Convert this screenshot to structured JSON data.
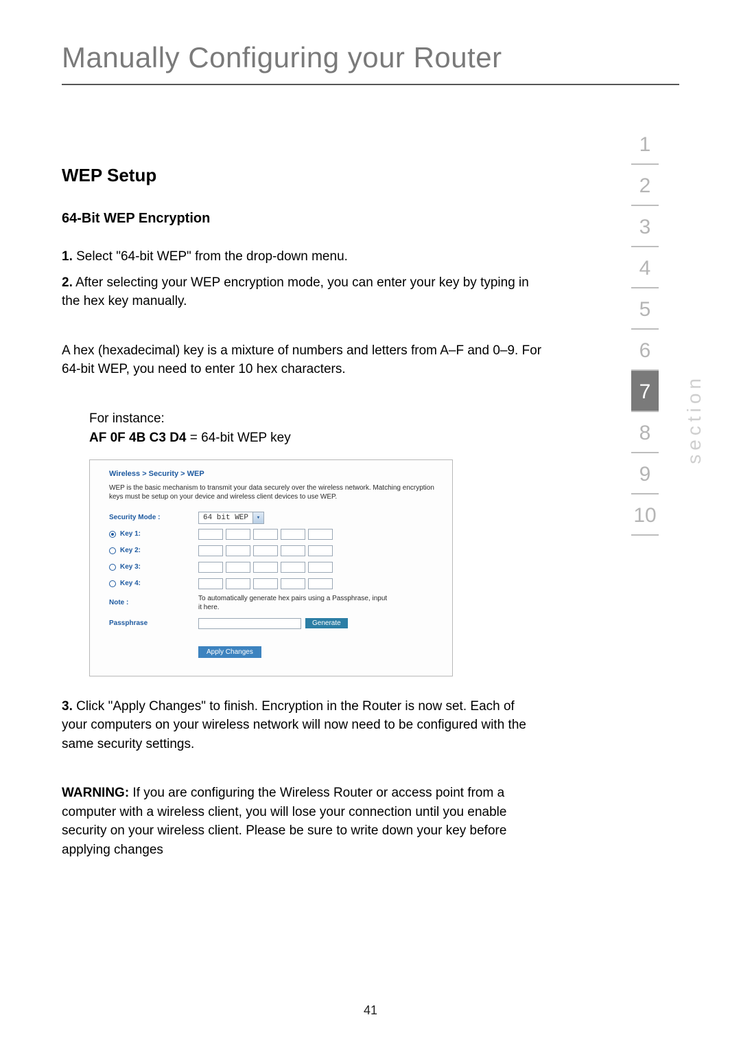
{
  "title": "Manually Configuring your Router",
  "h2": "WEP Setup",
  "h3": "64-Bit WEP Encryption",
  "steps": {
    "s1_num": "1.",
    "s1_text": " Select \"64-bit WEP\" from the drop-down menu.",
    "s2_num": "2.",
    "s2_text": " After selecting your WEP encryption mode, you can enter your key by typing in the hex key manually.",
    "s3_num": "3.",
    "s3_text": " Click \"Apply Changes\" to finish. Encryption in the Router is now set. Each of your computers on your wireless network will now need to be configured with the same security settings."
  },
  "hex_para": "A hex (hexadecimal) key is a mixture of numbers and letters from A–F and 0–9. For 64-bit WEP, you need to enter 10 hex characters.",
  "example": {
    "lead": "For instance:",
    "bold": "AF 0F 4B C3 D4",
    "rest": " = 64-bit WEP key"
  },
  "warning": {
    "label": "WARNING:",
    "text": " If you are configuring the Wireless Router or access point from a computer with a wireless client, you will lose your connection until you enable security on your wireless client. Please be sure to write down your key before applying changes"
  },
  "shot": {
    "crumb": "Wireless > Security > WEP",
    "desc": "WEP is the basic mechanism to transmit your data securely over the wireless network. Matching encryption keys must be setup on your device and wireless client devices to use WEP.",
    "mode_label": "Security Mode :",
    "mode_value": "64 bit WEP",
    "keys": [
      "Key 1:",
      "Key 2:",
      "Key 3:",
      "Key 4:"
    ],
    "note_label": "Note :",
    "note_text": "To automatically generate hex pairs using a Passphrase, input it here.",
    "pass_label": "Passphrase",
    "gen_btn": "Generate",
    "apply_btn": "Apply Changes"
  },
  "nav": {
    "items": [
      "1",
      "2",
      "3",
      "4",
      "5",
      "6",
      "7",
      "8",
      "9",
      "10"
    ],
    "active_index": 6,
    "section_label": "section"
  },
  "page_number": "41"
}
